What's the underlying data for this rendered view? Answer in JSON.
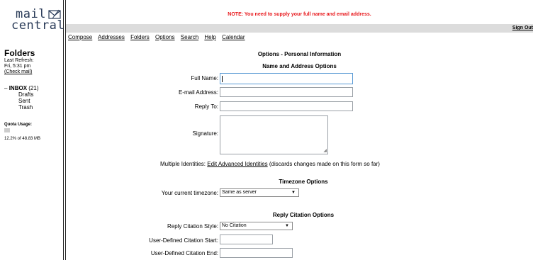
{
  "logo": {
    "line1": "mail",
    "line2": "central"
  },
  "sidebar": {
    "title": "Folders",
    "last_refresh_label": "Last Refresh:",
    "last_refresh_time": "Fri, 5:31 pm",
    "check_mail": "(Check mail)",
    "inbox_label": "INBOX",
    "inbox_count": "(21)",
    "folders": [
      "Drafts",
      "Sent",
      "Trash"
    ],
    "quota_label": "Quota Usage:",
    "quota_text": "12.2% of 48.83 MB",
    "quota_fraction": 0.122
  },
  "notice": "NOTE: You need to supply your full name and email address.",
  "signout": "Sign Out",
  "menu": [
    "Compose",
    "Addresses",
    "Folders",
    "Options",
    "Search",
    "Help",
    "Calendar"
  ],
  "page_title": "Options - Personal Information",
  "sections": {
    "name_address": "Name and Address Options",
    "timezone": "Timezone Options",
    "reply_citation": "Reply Citation Options"
  },
  "fields": {
    "full_name": {
      "label": "Full Name:",
      "value": ""
    },
    "email": {
      "label": "E-mail Address:",
      "value": ""
    },
    "reply_to": {
      "label": "Reply To:",
      "value": ""
    },
    "signature": {
      "label": "Signature:",
      "value": ""
    },
    "timezone": {
      "label": "Your current timezone:",
      "value": "Same as server"
    },
    "citation_style": {
      "label": "Reply Citation Style:",
      "value": "No Citation"
    },
    "citation_start": {
      "label": "User-Defined Citation Start:",
      "value": ""
    },
    "citation_end": {
      "label": "User-Defined Citation End:",
      "value": ""
    }
  },
  "identities": {
    "label": "Multiple Identities:",
    "link": "Edit Advanced Identities",
    "note": "(discards changes made on this form so far)"
  },
  "colors": {
    "notice": "#e8181c",
    "bar": "#dcdcdc",
    "logo": "#2a3b58"
  }
}
